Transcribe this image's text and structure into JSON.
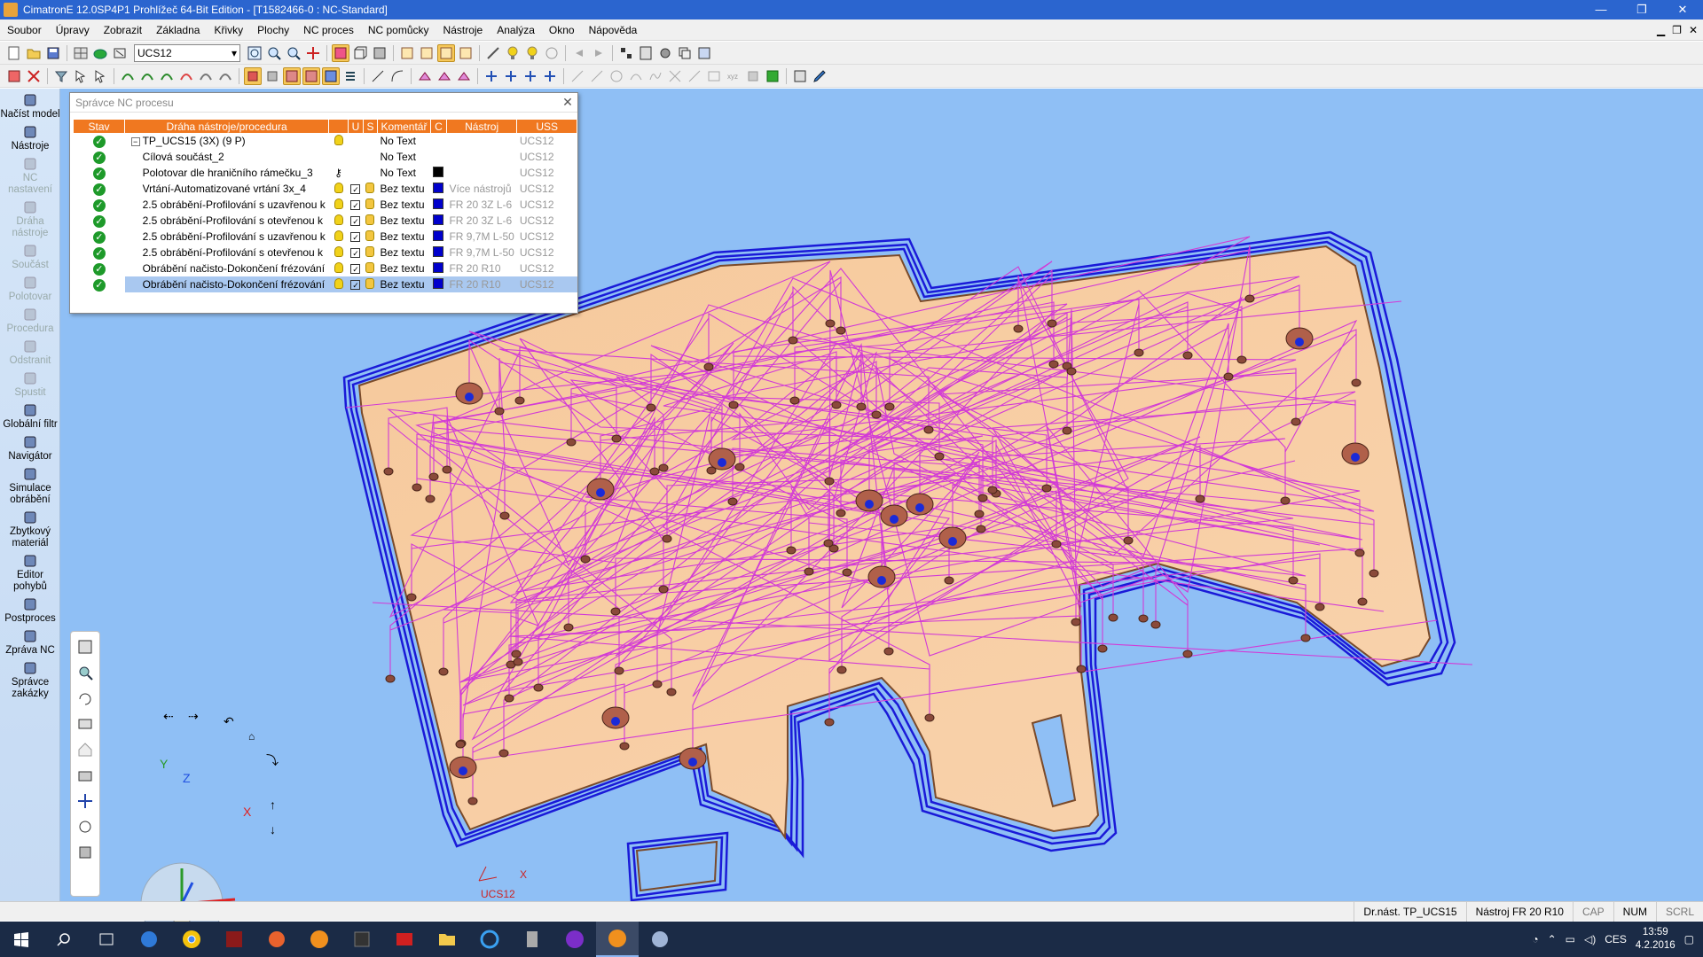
{
  "window": {
    "title": "CimatronE 12.0SP4P1  Prohlížeč 64-Bit Edition - [T1582466-0 : NC-Standard]",
    "min": "—",
    "max": "❐",
    "close": "✕"
  },
  "menu": [
    "Soubor",
    "Úpravy",
    "Zobrazit",
    "Základna",
    "Křivky",
    "Plochy",
    "NC proces",
    "NC pomůcky",
    "Nástroje",
    "Analýza",
    "Okno",
    "Nápověda"
  ],
  "ucs_select": "UCS12",
  "leftpanel": [
    {
      "label": "Načíst model",
      "enabled": true,
      "icon": "load-model-icon"
    },
    {
      "label": "Nástroje",
      "enabled": true,
      "icon": "tools-icon"
    },
    {
      "label": "NC nastavení",
      "enabled": false,
      "icon": "nc-settings-icon"
    },
    {
      "label": "Dráha nástroje",
      "enabled": false,
      "icon": "toolpath-icon"
    },
    {
      "label": "Součást",
      "enabled": false,
      "icon": "part-icon"
    },
    {
      "label": "Polotovar",
      "enabled": false,
      "icon": "stock-icon"
    },
    {
      "label": "Procedura",
      "enabled": false,
      "icon": "procedure-icon"
    },
    {
      "label": "Odstranit",
      "enabled": false,
      "icon": "remove-icon"
    },
    {
      "label": "Spustit",
      "enabled": false,
      "icon": "run-icon"
    },
    {
      "label": "Globální filtr",
      "enabled": true,
      "icon": "global-filter-icon"
    },
    {
      "label": "Navigátor",
      "enabled": true,
      "icon": "navigator-icon"
    },
    {
      "label": "Simulace obrábění",
      "enabled": true,
      "icon": "simulation-icon"
    },
    {
      "label": "Zbytkový materiál",
      "enabled": true,
      "icon": "remnant-material-icon"
    },
    {
      "label": "Editor pohybů",
      "enabled": true,
      "icon": "motion-editor-icon"
    },
    {
      "label": "Postproces",
      "enabled": true,
      "icon": "postprocess-icon"
    },
    {
      "label": "Zpráva NC",
      "enabled": true,
      "icon": "nc-report-icon"
    },
    {
      "label": "Správce zakázky",
      "enabled": true,
      "icon": "job-manager-icon"
    }
  ],
  "ncmanager": {
    "title": "Správce NC procesu",
    "columns": [
      "Stav",
      "Dráha nástroje/procedura",
      "",
      "U",
      "S",
      "Komentář",
      "C",
      "Nástroj",
      "USS"
    ],
    "rows": [
      {
        "name": "TP_UCS15 (3X) (9 P)",
        "comment": "No Text",
        "tool": "",
        "uss": "UCS12",
        "bulb": true,
        "u": false,
        "s": false,
        "color": "",
        "tree": true
      },
      {
        "name": "Cílová součást_2",
        "comment": "No Text",
        "tool": "",
        "uss": "UCS12",
        "bulb": false,
        "u": false,
        "s": false,
        "color": ""
      },
      {
        "name": "Polotovar dle hraničního rámečku_3",
        "comment": "No Text",
        "tool": "",
        "uss": "UCS12",
        "bulb": false,
        "u": false,
        "s": false,
        "color": "#000000",
        "key": true
      },
      {
        "name": "Vrtání-Automatizované vrtání 3x_4",
        "comment": "Bez textu",
        "tool": "Více nástrojů",
        "uss": "UCS12",
        "bulb": true,
        "u": true,
        "s": true,
        "color": "#0000cc"
      },
      {
        "name": "2.5 obrábění-Profilování s uzavřenou k",
        "comment": "Bez textu",
        "tool": "FR 20 3Z L-6",
        "uss": "UCS12",
        "bulb": true,
        "u": true,
        "s": true,
        "color": "#0000cc"
      },
      {
        "name": "2.5 obrábění-Profilování s otevřenou k",
        "comment": "Bez textu",
        "tool": "FR 20 3Z L-6",
        "uss": "UCS12",
        "bulb": true,
        "u": true,
        "s": true,
        "color": "#0000cc"
      },
      {
        "name": "2.5 obrábění-Profilování s uzavřenou k",
        "comment": "Bez textu",
        "tool": "FR 9,7M L-50",
        "uss": "UCS12",
        "bulb": true,
        "u": true,
        "s": true,
        "color": "#0000cc"
      },
      {
        "name": "2.5 obrábění-Profilování s otevřenou k",
        "comment": "Bez textu",
        "tool": "FR 9,7M L-50",
        "uss": "UCS12",
        "bulb": true,
        "u": true,
        "s": true,
        "color": "#0000cc"
      },
      {
        "name": "Obrábění načisto-Dokončení frézování",
        "comment": "Bez textu",
        "tool": "FR 20 R10",
        "uss": "UCS12",
        "bulb": true,
        "u": true,
        "s": true,
        "color": "#0000cc"
      },
      {
        "name": "Obrábění načisto-Dokončení frézování",
        "comment": "Bez textu",
        "tool": "FR 20 R10",
        "uss": "UCS12",
        "bulb": true,
        "u": true,
        "s": true,
        "color": "#0000cc",
        "selected": true
      }
    ]
  },
  "viewport": {
    "ucs_label": "UCS12",
    "axis_x": "X",
    "axis_y": "Y",
    "axis_z": "Z",
    "small_x": "X",
    "part_color": "#f7caa0",
    "background": "#8fbff5",
    "path_color": "#d23ad6"
  },
  "status": {
    "drnast": "Dr.nást.  TP_UCS15",
    "tool": "Nástroj  FR 20 R10",
    "cap": "CAP",
    "num": "NUM",
    "scrl": "SCRL"
  },
  "taskbar": {
    "lang": "CES",
    "time": "13:59",
    "date": "4.2.2016"
  }
}
